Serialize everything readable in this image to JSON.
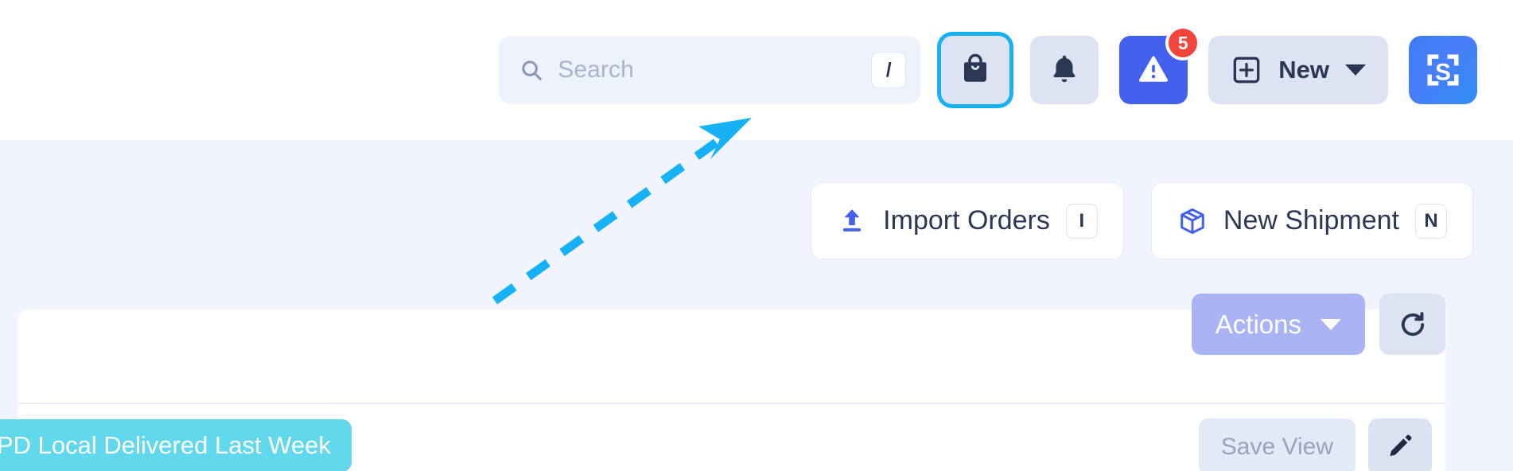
{
  "header": {
    "search": {
      "placeholder": "Search",
      "value": "",
      "shortcut": "/",
      "icon": "search-icon"
    },
    "buttons": [
      {
        "name": "orders-bag-button",
        "icon": "shopping-bag-icon",
        "focused": true
      },
      {
        "name": "notifications-button",
        "icon": "bell-icon",
        "focused": false
      },
      {
        "name": "alerts-button",
        "icon": "warning-triangle-icon",
        "badge": "5",
        "focused": false
      }
    ],
    "new_button": {
      "label": "New",
      "icon": "plus-square-icon",
      "caret": "chevron-down-icon"
    },
    "logo": {
      "letter": "S",
      "icon": "scan-frame-icon"
    }
  },
  "toolbar": {
    "import_orders": {
      "label": "Import Orders",
      "shortcut": "I",
      "icon": "upload-icon"
    },
    "new_shipment": {
      "label": "New Shipment",
      "shortcut": "N",
      "icon": "package-box-icon"
    }
  },
  "card": {
    "actions_button": {
      "label": "Actions",
      "caret": "chevron-down-icon",
      "disabled": true
    },
    "refresh_button": {
      "icon": "refresh-icon"
    },
    "save_view_button": {
      "label": "Save View",
      "disabled": true
    },
    "edit_button": {
      "icon": "pencil-icon"
    },
    "filter_chip": {
      "label": "PD Local Delivered Last Week"
    }
  },
  "annotation": {
    "type": "dashed-arrow",
    "points_to": "orders-bag-button",
    "color": "#17b1f5"
  },
  "colors": {
    "page_bg": "#f1f4fe",
    "header_bg": "#ffffff",
    "accent_blue": "#4361ee",
    "badge_red": "#f1453d",
    "chip_cyan": "#62d8ec",
    "focus_ring": "#17b1f5",
    "actions_disabled": "#aab4f5",
    "icon_btn_bg": "#dde3f3",
    "text_dark": "#2c3853"
  }
}
